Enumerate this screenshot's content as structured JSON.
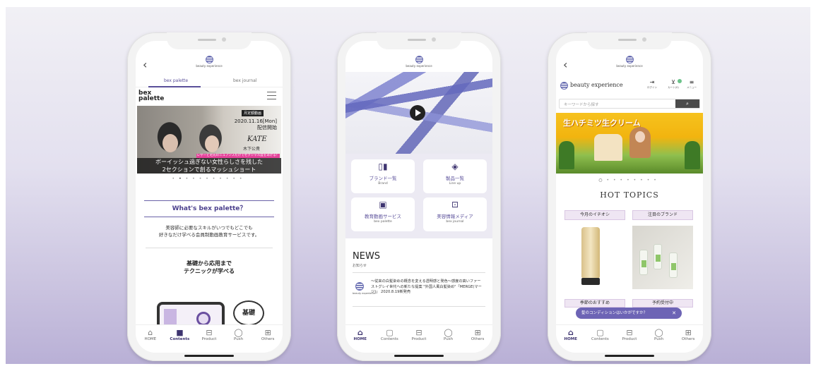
{
  "phone1": {
    "logo_caption": "beauty experience",
    "tabs": [
      "bex palette",
      "bex journal"
    ],
    "brand_logo": "bex\npalette",
    "hero": {
      "tag": "月定額動画",
      "date_line1": "2020.11.16[Mon]",
      "date_line2": "配信開始",
      "brand": "KATE",
      "artist": "木下公貴",
      "pink_strip": "レザーと毛先のニュアンスだけでセクシャル度をあげる！",
      "caption_line1": "ボーイッシュ過ぎない女性らしさを残した",
      "caption_line2": "2セクションで創るマッシュショート"
    },
    "section_title": "What's bex palette？",
    "description_line1": "美容師に必要なスキルがいつでもどこでも",
    "description_line2": "好きなだけ学べる会員制動画教育サービスです。",
    "learn_line1": "基礎から応用まで",
    "learn_line2": "テクニックが学べる",
    "bubble": "基礎",
    "tabbar": [
      "HOME",
      "Contents",
      "Product",
      "Push",
      "Others"
    ],
    "active_tab": "Contents"
  },
  "phone2": {
    "logo_caption": "beauty experience",
    "menu": [
      {
        "jp": "ブランド一覧",
        "en": "Brand",
        "icon": "bottles-icon"
      },
      {
        "jp": "製品一覧",
        "en": "Line up",
        "icon": "tube-icon"
      },
      {
        "jp": "教育動画サービス",
        "en": "bex palette",
        "icon": "video-icon"
      },
      {
        "jp": "美容情報メディア",
        "en": "bex journal",
        "icon": "book-icon"
      }
    ],
    "news_title": "NEWS",
    "news_sub": "お知らせ",
    "news_item": "～従来の白髪染めの概念を変える透明感と発色～感度の高いファーストグレイ世代への新たな提案 \"外国人風白髪染め\"「MERGE(マージ)」 2020.8.19新発売",
    "news_logo_caption": "beauty experience",
    "tabbar": [
      "HOME",
      "Contents",
      "Product",
      "Push",
      "Others"
    ],
    "active_tab": "HOME"
  },
  "phone3": {
    "logo_caption": "beauty experience",
    "brand_name": "beauty experience",
    "icons": [
      "ログイン",
      "カート(0)",
      "メニュー"
    ],
    "cart_count": "0",
    "search_placeholder": "キーワードから探す",
    "hero_title": "生ハチミツ生クリーム",
    "hot_topics": "HOT TOPICS",
    "card1": "今月のイチオシ",
    "card2": "注目のブランド",
    "card3": "季節のおすすめ",
    "card4": "予約受付中",
    "toast": "髪のコンディションはいかがですか？",
    "tabbar": [
      "HOME",
      "Contents",
      "Product",
      "Push",
      "Others"
    ],
    "active_tab": "HOME"
  },
  "colors": {
    "accent": "#5a4f9a",
    "toast": "#6d64b5",
    "pink": "#e5439a"
  }
}
